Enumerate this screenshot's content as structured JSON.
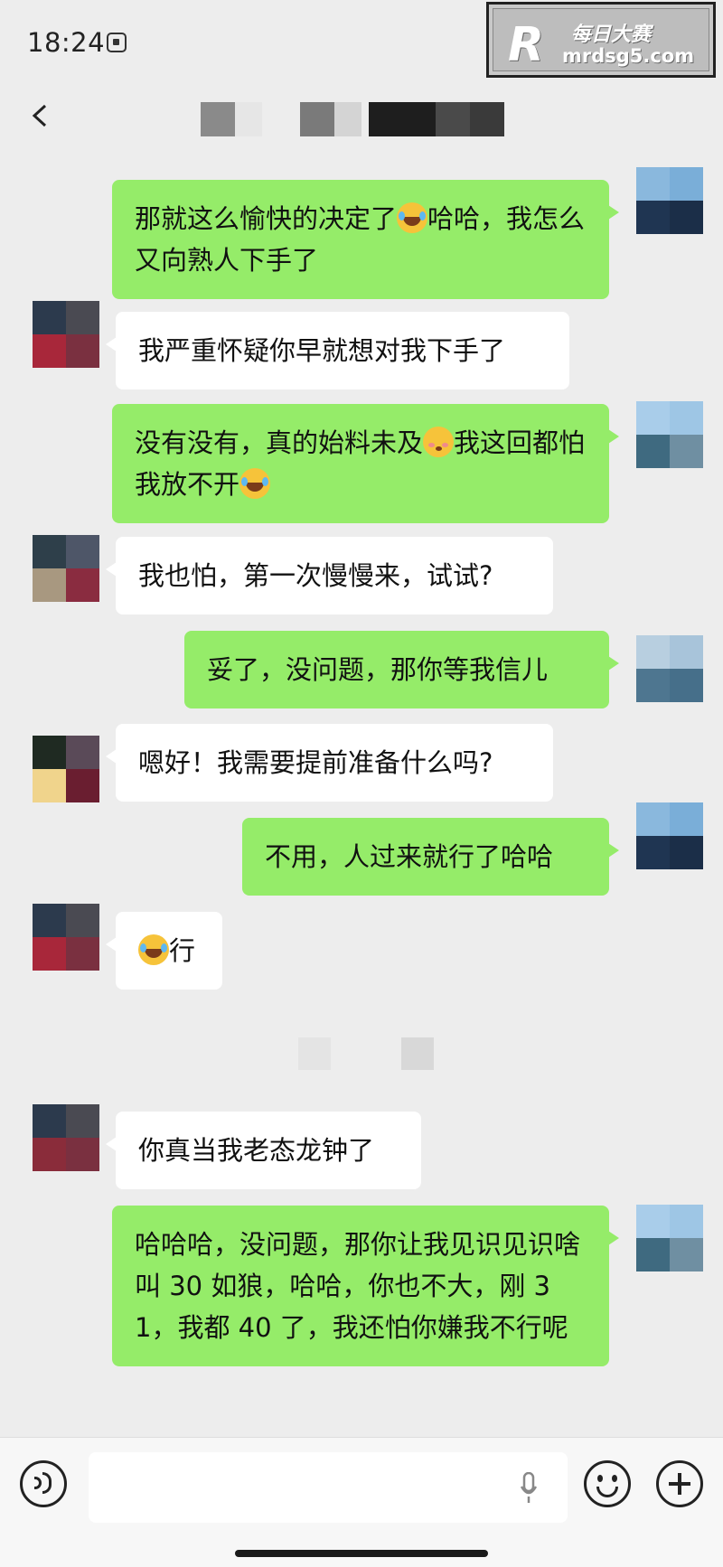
{
  "status_bar": {
    "time": "18:24"
  },
  "watermark": {
    "logo": "R",
    "title": "每日大赛",
    "url": "mrdsg5.com"
  },
  "chat": {
    "messages": [
      {
        "side": "out",
        "parts": [
          {
            "t": "那就这么愉快的决定了"
          },
          {
            "emoji": "laugh"
          },
          {
            "t": "哈哈，我怎么又向熟人下手了"
          }
        ]
      },
      {
        "side": "in",
        "parts": [
          {
            "t": "我严重怀疑你早就想对我下手了"
          }
        ]
      },
      {
        "side": "out",
        "parts": [
          {
            "t": "没有没有，真的始料未及"
          },
          {
            "emoji": "blush"
          },
          {
            "t": "我这回都怕我放不开"
          },
          {
            "emoji": "laugh"
          }
        ]
      },
      {
        "side": "in",
        "parts": [
          {
            "t": "我也怕，第一次慢慢来，试试?"
          }
        ]
      },
      {
        "side": "out",
        "parts": [
          {
            "t": "妥了，没问题，那你等我信儿"
          }
        ]
      },
      {
        "side": "in",
        "parts": [
          {
            "t": "嗯好！我需要提前准备什么吗?"
          }
        ]
      },
      {
        "side": "out",
        "parts": [
          {
            "t": "不用，人过来就行了哈哈"
          }
        ]
      },
      {
        "side": "in",
        "parts": [
          {
            "emoji": "laugh"
          },
          {
            "t": "行"
          }
        ]
      },
      {
        "side": "in",
        "parts": [
          {
            "t": "你真当我老态龙钟了"
          }
        ]
      },
      {
        "side": "out",
        "parts": [
          {
            "t": "哈哈哈，没问题，那你让我见识见识啥叫 30 如狼，哈哈，你也不大，刚 31，我都 40 了，我还怕你嫌我不行呢"
          }
        ]
      }
    ]
  },
  "input_bar": {
    "placeholder": ""
  },
  "colors": {
    "outgoing_bubble": "#95ec69",
    "incoming_bubble": "#ffffff",
    "background": "#ededed"
  }
}
